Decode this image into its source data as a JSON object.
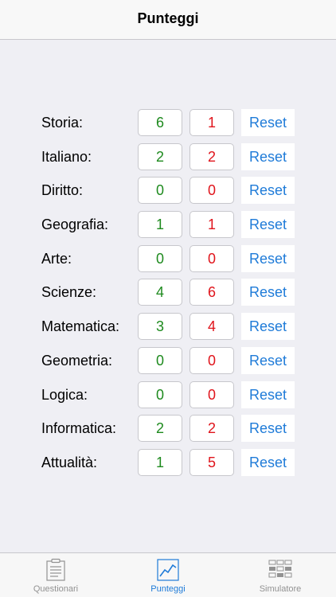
{
  "header": {
    "title": "Punteggi"
  },
  "scores": [
    {
      "subject": "Storia:",
      "correct": "6",
      "wrong": "1",
      "reset": "Reset"
    },
    {
      "subject": "Italiano:",
      "correct": "2",
      "wrong": "2",
      "reset": "Reset"
    },
    {
      "subject": "Diritto:",
      "correct": "0",
      "wrong": "0",
      "reset": "Reset"
    },
    {
      "subject": "Geografia:",
      "correct": "1",
      "wrong": "1",
      "reset": "Reset"
    },
    {
      "subject": "Arte:",
      "correct": "0",
      "wrong": "0",
      "reset": "Reset"
    },
    {
      "subject": "Scienze:",
      "correct": "4",
      "wrong": "6",
      "reset": "Reset"
    },
    {
      "subject": "Matematica:",
      "correct": "3",
      "wrong": "4",
      "reset": "Reset"
    },
    {
      "subject": "Geometria:",
      "correct": "0",
      "wrong": "0",
      "reset": "Reset"
    },
    {
      "subject": "Logica:",
      "correct": "0",
      "wrong": "0",
      "reset": "Reset"
    },
    {
      "subject": "Informatica:",
      "correct": "2",
      "wrong": "2",
      "reset": "Reset"
    },
    {
      "subject": "Attualità:",
      "correct": "1",
      "wrong": "5",
      "reset": "Reset"
    }
  ],
  "tabs": [
    {
      "label": "Questionari",
      "icon": "document-icon",
      "active": false
    },
    {
      "label": "Punteggi",
      "icon": "chart-icon",
      "active": true
    },
    {
      "label": "Simulatore",
      "icon": "grid-icon",
      "active": false
    }
  ],
  "colors": {
    "accent": "#1f7bd8",
    "correct": "#1e8a1e",
    "wrong": "#e0141b"
  }
}
